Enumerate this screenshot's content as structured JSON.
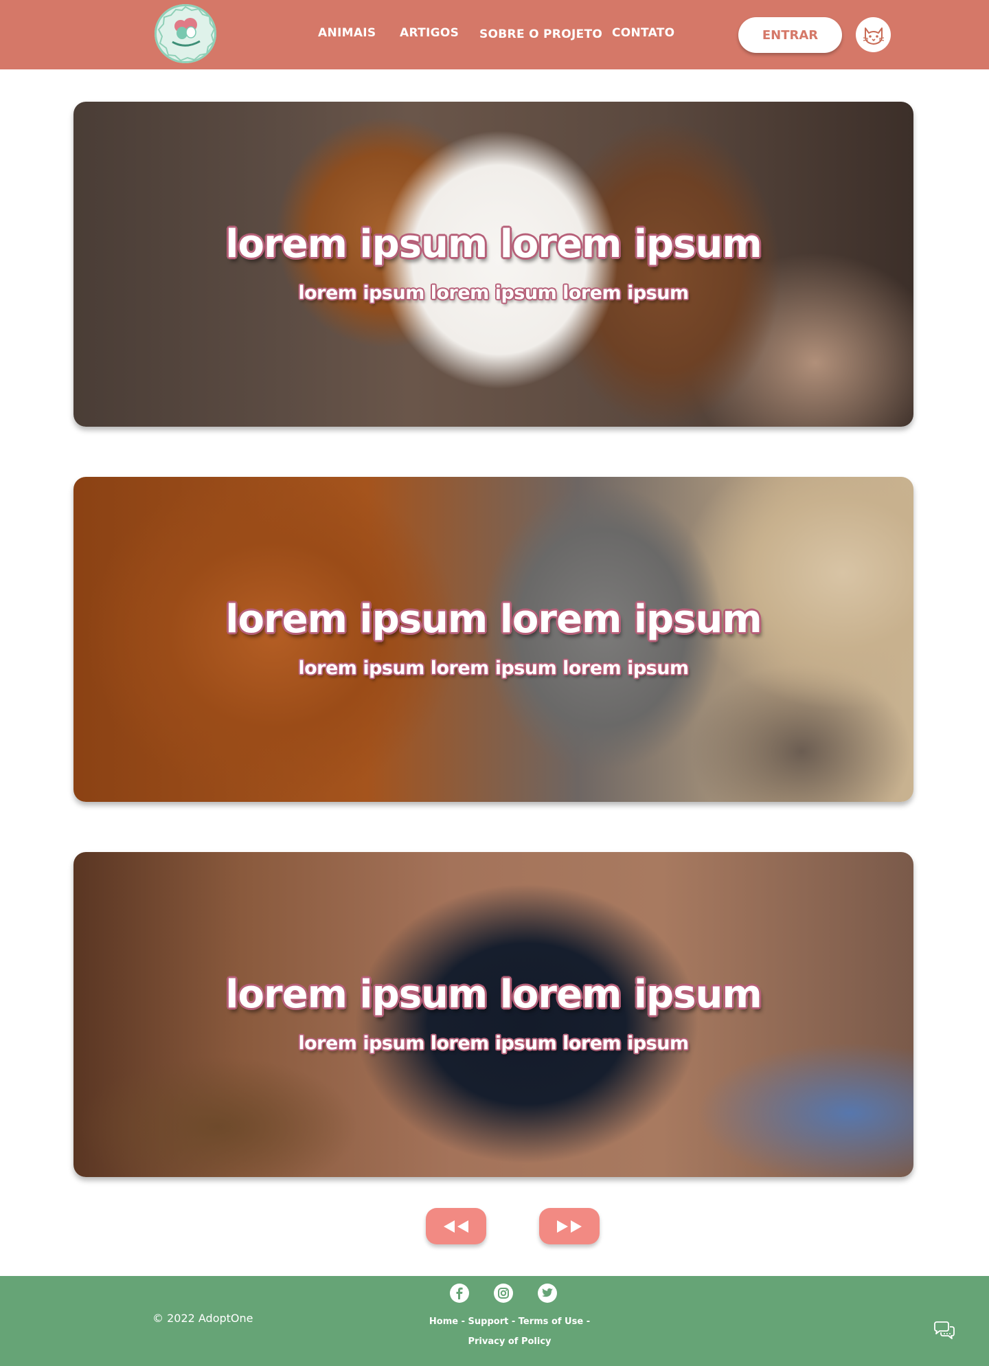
{
  "header": {
    "logo_text": "AdoptOne",
    "nav": [
      "ANIMAIS",
      "ARTIGOS",
      "SOBRE O PROJETO",
      "CONTATO"
    ],
    "login_label": "ENTRAR",
    "avatar_icon": "cat-face-icon"
  },
  "cards": [
    {
      "title": "lorem ipsum lorem ipsum",
      "subtitle": "lorem ipsum lorem ipsum lorem ipsum",
      "image": "puppy-brown-white"
    },
    {
      "title": "lorem ipsum lorem ipsum",
      "subtitle": "lorem ipsum lorem ipsum lorem ipsum",
      "image": "dog-cat-hands"
    },
    {
      "title": "lorem ipsum lorem ipsum",
      "subtitle": "lorem ipsum lorem ipsum lorem ipsum",
      "image": "black-puppy"
    }
  ],
  "pager": {
    "prev_icon": "rewind-icon",
    "next_icon": "fast-forward-icon"
  },
  "footer": {
    "copyright": "© 2022 AdoptOne",
    "social": [
      "facebook-icon",
      "instagram-icon",
      "twitter-icon"
    ],
    "links_line1": "Home - Support - Terms of Use -",
    "links_line2": "Privacy of Policy",
    "chat_icon": "chat-bubbles-icon"
  },
  "colors": {
    "header_bg": "#d57868",
    "footer_bg": "#66a476",
    "pager_bg": "#f28a83",
    "title_outline": "#b65f78"
  }
}
